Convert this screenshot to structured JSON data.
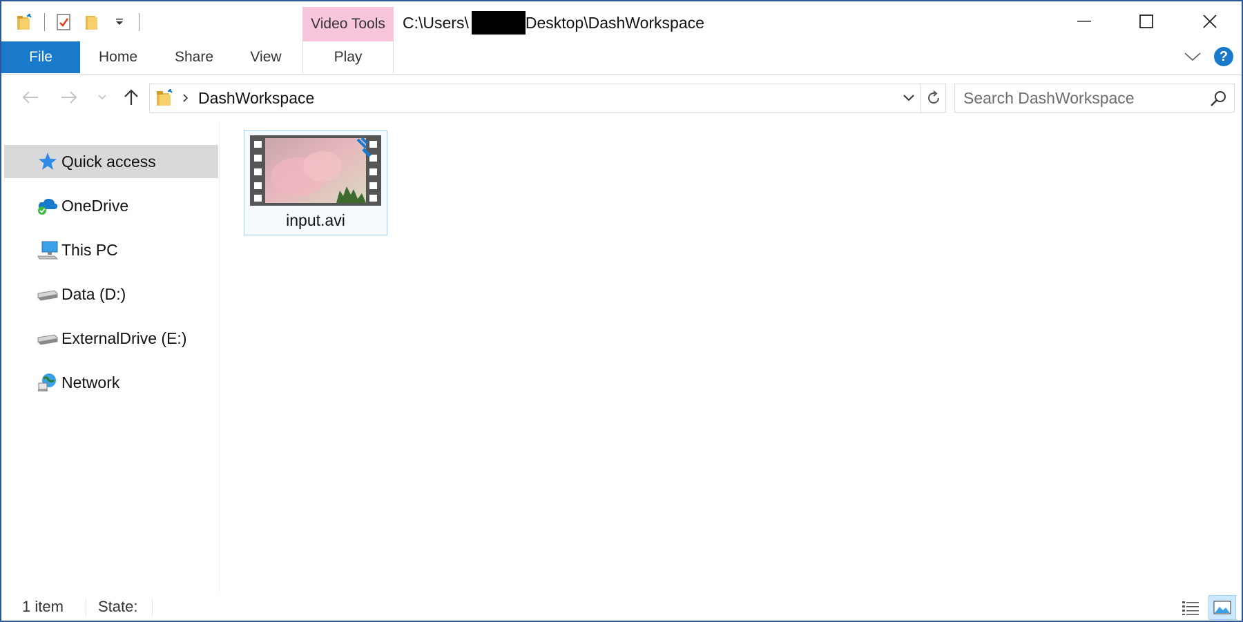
{
  "window": {
    "title_prefix": "C:\\Users\\",
    "title_suffix": "Desktop\\DashWorkspace",
    "context_tab_group": "Video Tools"
  },
  "ribbon": {
    "tabs": [
      {
        "label": "File"
      },
      {
        "label": "Home"
      },
      {
        "label": "Share"
      },
      {
        "label": "View"
      },
      {
        "label": "Play"
      }
    ],
    "help_label": "?"
  },
  "address": {
    "crumb": "DashWorkspace",
    "search_placeholder": "Search DashWorkspace"
  },
  "sidebar": {
    "items": [
      {
        "label": "Quick access",
        "icon": "star-icon",
        "selected": true
      },
      {
        "label": "OneDrive",
        "icon": "cloud-icon"
      },
      {
        "label": "This PC",
        "icon": "computer-icon"
      },
      {
        "label": "Data (D:)",
        "icon": "drive-icon"
      },
      {
        "label": "ExternalDrive (E:)",
        "icon": "drive-icon"
      },
      {
        "label": "Network",
        "icon": "network-icon"
      }
    ]
  },
  "files": [
    {
      "name": "input.avi",
      "icon": "video-file-icon"
    }
  ],
  "status": {
    "item_count": "1 item",
    "state": "State:"
  },
  "colors": {
    "accent": "#1979ca",
    "context_tab": "#f7c5dc",
    "selection_border": "#99d1ff",
    "sidebar_selected": "#d9d9d9"
  }
}
